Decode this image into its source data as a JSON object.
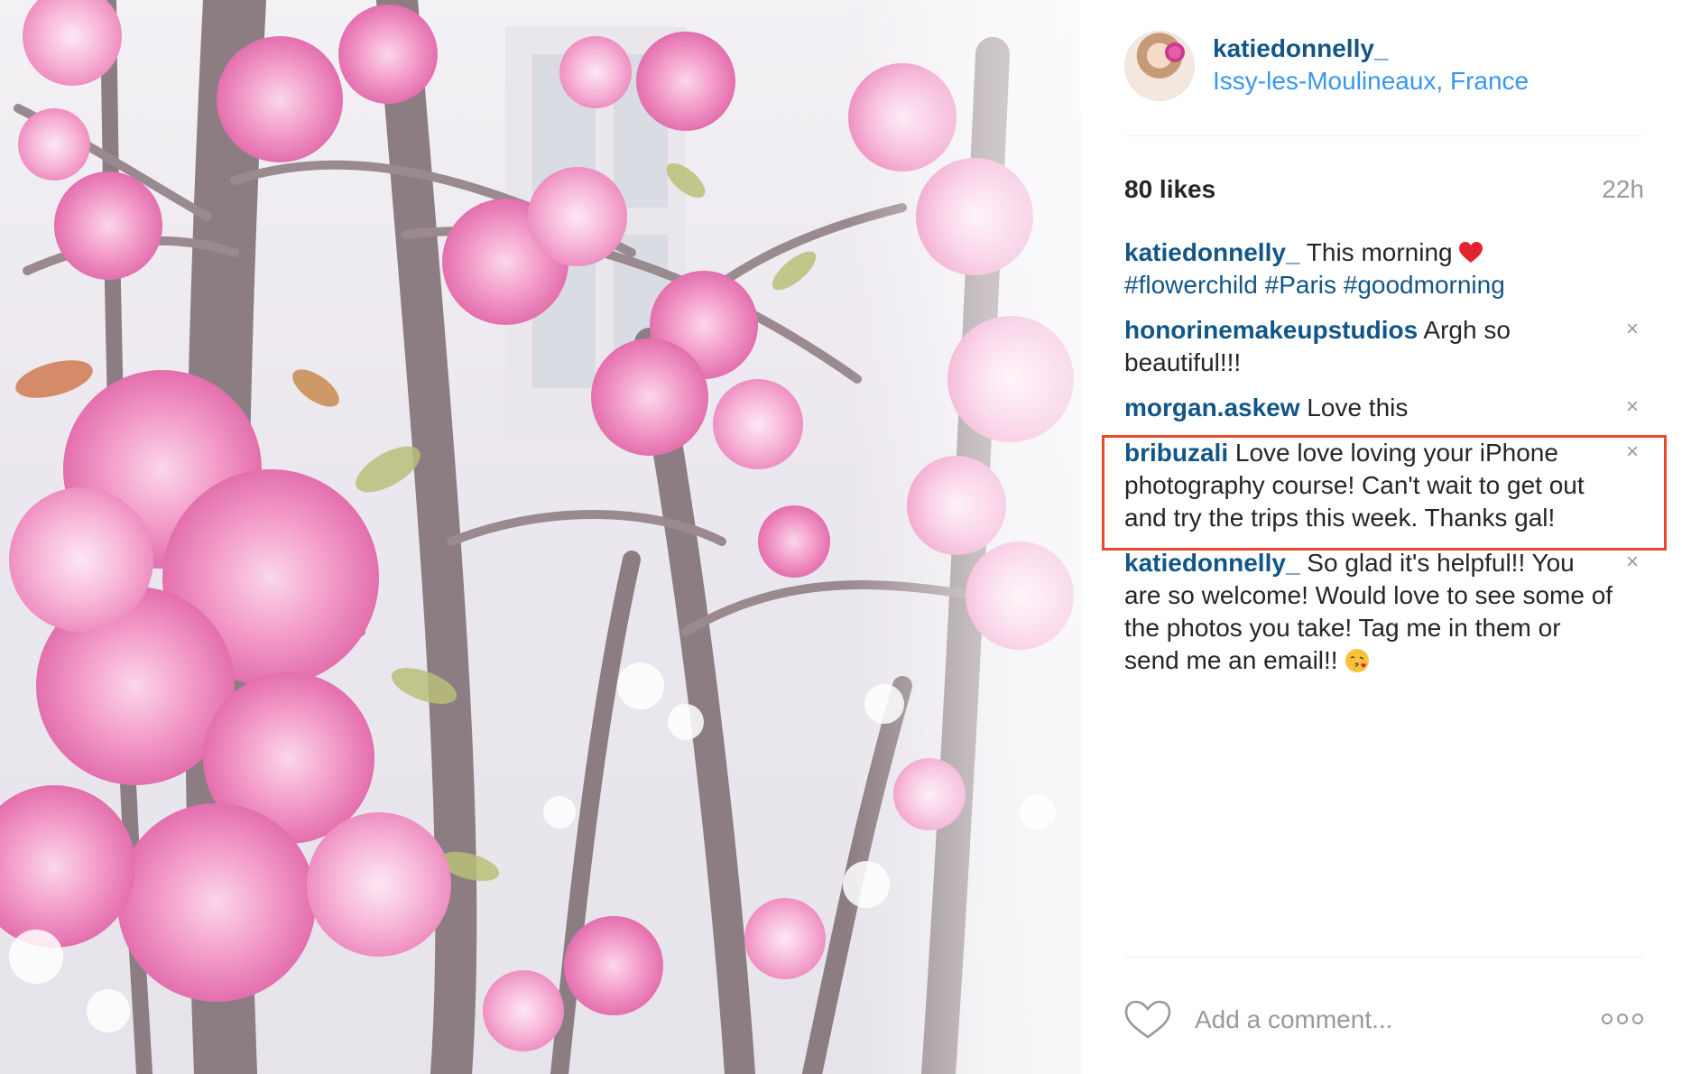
{
  "post": {
    "photo_alt": "Pink cherry blossoms on tree branches",
    "author": {
      "username": "katiedonnelly_",
      "location": "Issy-les-Moulineaux, France",
      "avatar_icon": "avatar-photo"
    },
    "likes": "80 likes",
    "time_ago": "22h"
  },
  "comments": [
    {
      "user": "katiedonnelly_",
      "text": " This morning ",
      "emoji": "red-heart-icon",
      "tags": "#flowerchild #Paris #goodmorning",
      "deletable": false
    },
    {
      "user": "honorinemakeupstudios",
      "text": " Argh so beautiful!!!",
      "deletable": true
    },
    {
      "user": "morgan.askew",
      "text": " Love this",
      "deletable": true
    },
    {
      "user": "bribuzali",
      "text": " Love love loving your iPhone photography course! Can't wait to get out and try the trips this week. Thanks gal!",
      "deletable": true,
      "highlighted": true
    },
    {
      "user": "katiedonnelly_",
      "text": " So glad it's helpful!! You are so welcome! Would love to see some of the photos you take! Tag me in them or send me an email!! ",
      "emoji": "kiss-face-icon",
      "deletable": true
    }
  ],
  "delete_glyph": "×",
  "footer": {
    "like_icon": "heart-outline-icon",
    "comment_placeholder": "Add a comment...",
    "more_icon": "more-options-icon"
  },
  "colors": {
    "username": "#125688",
    "location": "#3897f0",
    "muted": "#999999",
    "highlight_border": "#e84a2a"
  }
}
